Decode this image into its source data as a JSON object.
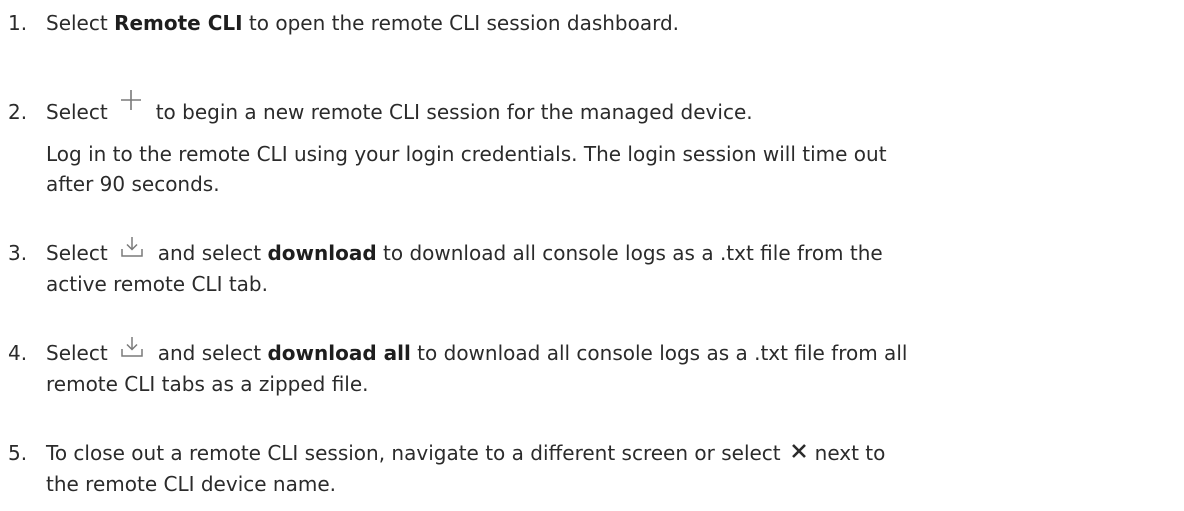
{
  "steps": [
    {
      "number": "1.",
      "before": "Select ",
      "bold": "Remote CLI",
      "after": " to open the remote CLI session dashboard."
    },
    {
      "number": "2.",
      "before": "Select",
      "icon": "plus-icon",
      "after": "to begin a new remote CLI session for the managed device.",
      "note_line1": "Log in to the remote CLI using your login credentials. The login session will time out",
      "note_line2": "after 90 seconds."
    },
    {
      "number": "3.",
      "before": "Select",
      "icon": "download-icon",
      "mid": "and select ",
      "bold": "download",
      "after": " to download all console logs as a .txt file from the",
      "line2": "active remote CLI tab."
    },
    {
      "number": "4.",
      "before": "Select",
      "icon": "download-icon",
      "mid": "and select ",
      "bold": "download all",
      "after": " to download all console logs as a .txt file from all",
      "line2": "remote CLI tabs as a zipped file."
    },
    {
      "number": "5.",
      "before": "To close out a remote CLI session, navigate to a different screen or select",
      "icon": "close-icon",
      "after": "next to",
      "line2": "the remote CLI device name."
    }
  ],
  "colors": {
    "text": "#2b2b2b",
    "icon": "#7a7a7a"
  }
}
